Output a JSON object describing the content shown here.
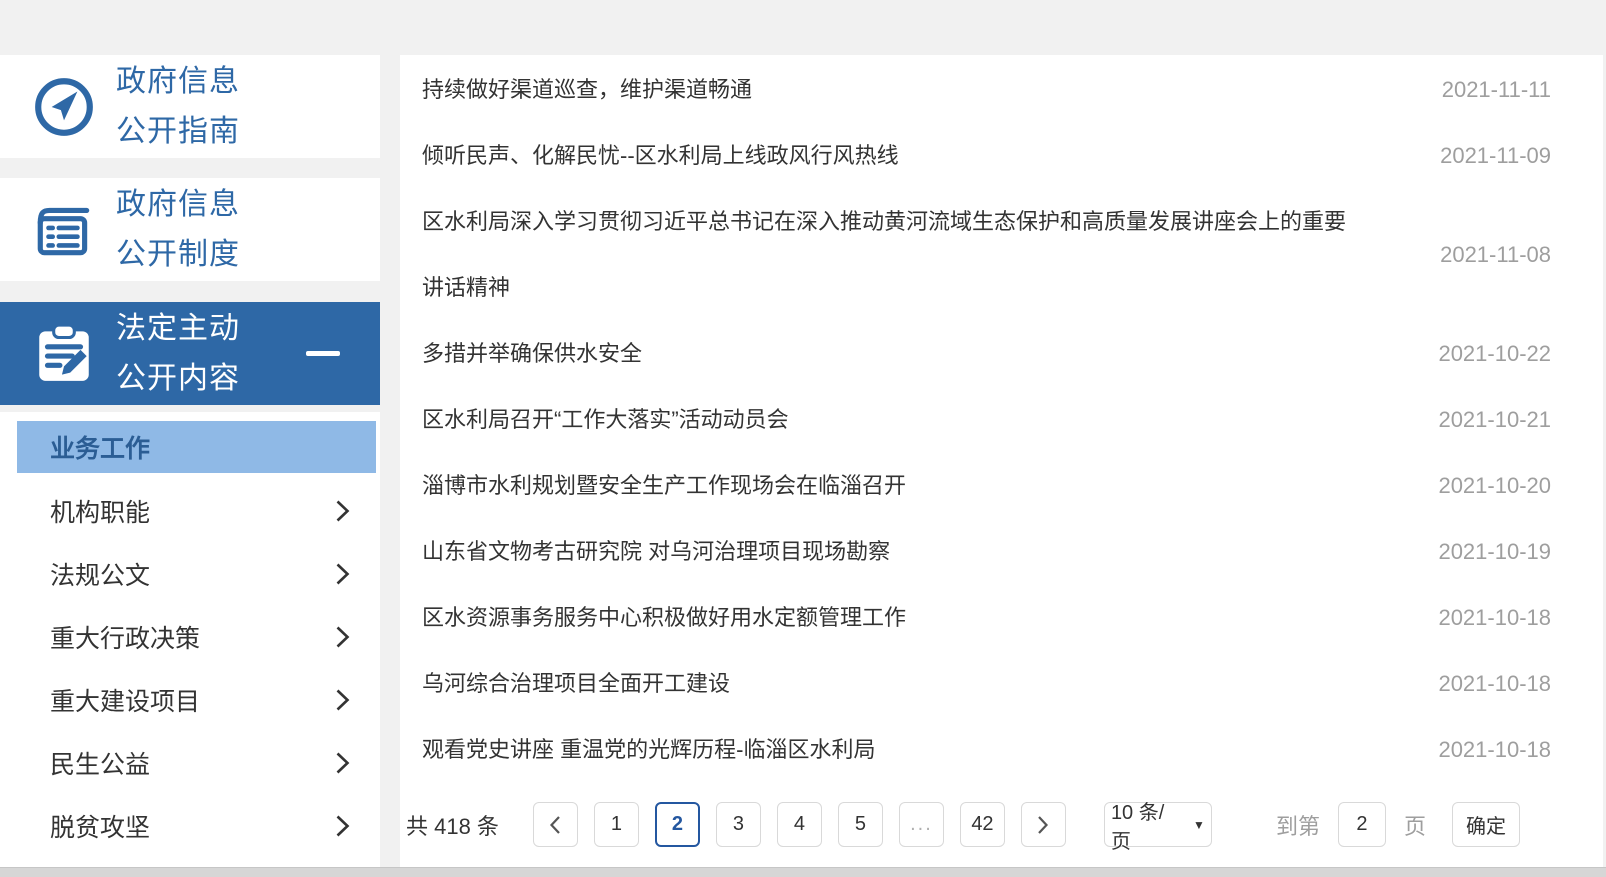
{
  "colors": {
    "accent_blue": "#2e68a6",
    "active_page_blue": "#2457a0",
    "subitem_highlight": "#8fb9e6",
    "subitem_highlight_text": "#2b5d94",
    "title_text": "#333333",
    "date_text": "#9e9e9e",
    "page_background": "#f1f1f1"
  },
  "sidebar": {
    "items": [
      {
        "icon": "compass-icon",
        "line1": "政府信息",
        "line2": "公开指南",
        "active": false
      },
      {
        "icon": "ledger-icon",
        "line1": "政府信息",
        "line2": "公开制度",
        "active": false
      },
      {
        "icon": "clipboard-pencil-icon",
        "line1": "法定主动",
        "line2": "公开内容",
        "active": true,
        "collapse_indicator": "minus"
      }
    ],
    "subitems": [
      {
        "label": "业务工作",
        "active": true
      },
      {
        "label": "机构职能",
        "active": false
      },
      {
        "label": "法规公文",
        "active": false
      },
      {
        "label": "重大行政决策",
        "active": false
      },
      {
        "label": "重大建设项目",
        "active": false
      },
      {
        "label": "民生公益",
        "active": false
      },
      {
        "label": "脱贫攻坚",
        "active": false
      }
    ]
  },
  "news": {
    "items": [
      {
        "title": "持续做好渠道巡查，维护渠道畅通",
        "date": "2021-11-11"
      },
      {
        "title": "倾听民声、化解民忧--区水利局上线政风行风热线",
        "date": "2021-11-09"
      },
      {
        "title": "区水利局深入学习贯彻习近平总书记在深入推动黄河流域生态保护和高质量发展讲座会上的重要讲话精神",
        "date": "2021-11-08"
      },
      {
        "title": "多措并举确保供水安全",
        "date": "2021-10-22"
      },
      {
        "title": "区水利局召开“工作大落实”活动动员会",
        "date": "2021-10-21"
      },
      {
        "title": "淄博市水利规划暨安全生产工作现场会在临淄召开",
        "date": "2021-10-20"
      },
      {
        "title": "山东省文物考古研究院 对乌河治理项目现场勘察",
        "date": "2021-10-19"
      },
      {
        "title": "区水资源事务服务中心积极做好用水定额管理工作",
        "date": "2021-10-18"
      },
      {
        "title": "乌河综合治理项目全面开工建设",
        "date": "2021-10-18"
      },
      {
        "title": "观看党史讲座 重温党的光辉历程-临淄区水利局",
        "date": "2021-10-18"
      }
    ]
  },
  "pagination": {
    "total_label": "共 418 条",
    "pages": [
      "1",
      "2",
      "3",
      "4",
      "5",
      "...",
      "42"
    ],
    "active_page": "2",
    "page_size_label": "10 条/页",
    "goto_prefix": "到第",
    "goto_value": "2",
    "goto_suffix": "页",
    "confirm_label": "确定"
  }
}
